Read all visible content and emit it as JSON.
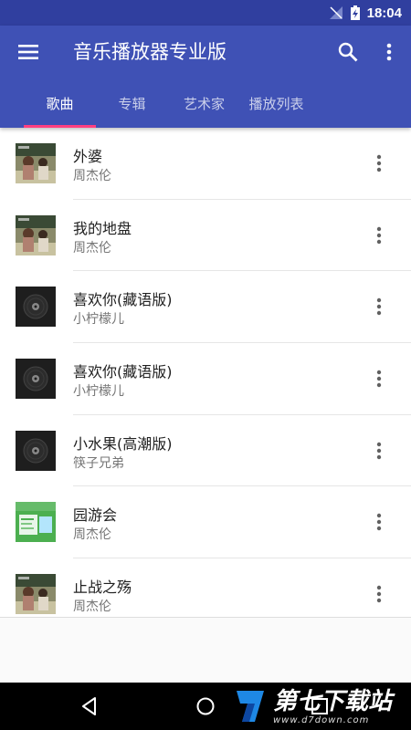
{
  "status_bar": {
    "time": "18:04"
  },
  "app_bar": {
    "title": "音乐播放器专业版",
    "color": "#3f51b5",
    "accent": "#ff4081",
    "icons": [
      "menu-icon",
      "search-icon",
      "more-vert-icon"
    ]
  },
  "tabs": [
    {
      "label": "歌曲",
      "active": true
    },
    {
      "label": "专辑",
      "active": false
    },
    {
      "label": "艺术家",
      "active": false
    },
    {
      "label": "播放列表",
      "active": false
    }
  ],
  "songs": [
    {
      "title": "外婆",
      "artist": "周杰伦",
      "art": "photo"
    },
    {
      "title": "我的地盘",
      "artist": "周杰伦",
      "art": "photo"
    },
    {
      "title": "喜欢你(藏语版)",
      "artist": "小柠檬儿",
      "art": "disc"
    },
    {
      "title": "喜欢你(藏语版)",
      "artist": "小柠檬儿",
      "art": "disc"
    },
    {
      "title": "小水果(高潮版)",
      "artist": "筷子兄弟",
      "art": "disc"
    },
    {
      "title": "园游会",
      "artist": "周杰伦",
      "art": "green"
    },
    {
      "title": "止战之殇",
      "artist": "周杰伦",
      "art": "photo"
    }
  ],
  "nav": {
    "icons": [
      "back-icon",
      "home-icon",
      "recents-icon"
    ]
  },
  "watermark": {
    "main": "第七下载站",
    "url": "www.d7down.com"
  }
}
